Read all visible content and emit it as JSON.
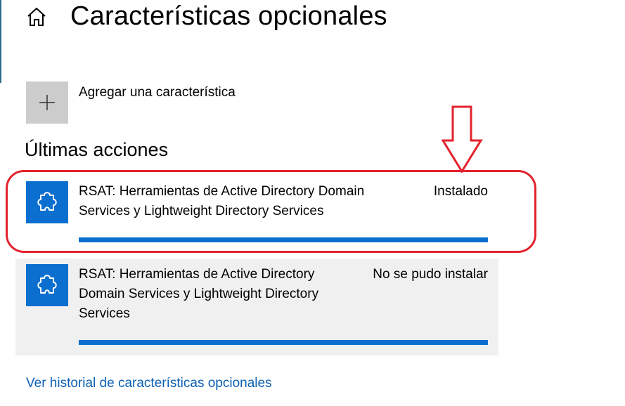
{
  "header": {
    "title": "Características opcionales",
    "home_icon": "home-icon"
  },
  "add_feature": {
    "label": "Agregar una característica",
    "icon": "plus-icon"
  },
  "recent_actions": {
    "heading": "Últimas acciones",
    "items": [
      {
        "name": "RSAT: Herramientas de Active Directory Domain Services y Lightweight Directory Services",
        "status": "Instalado",
        "progress": 1.0,
        "icon": "puzzle-piece-icon",
        "highlighted": true
      },
      {
        "name": "RSAT: Herramientas de Active Directory Domain Services y Lightweight Directory Services",
        "status": "No se pudo instalar",
        "progress": 1.0,
        "icon": "puzzle-piece-icon",
        "highlighted": false
      }
    ]
  },
  "footer": {
    "history_link": "Ver historial de características opcionales"
  },
  "colors": {
    "accent": "#0a6fcf",
    "annotation": "#e3222d",
    "link": "#0a5fb4",
    "add_tile": "#cccccc",
    "selected_row": "#f0f0f0"
  }
}
